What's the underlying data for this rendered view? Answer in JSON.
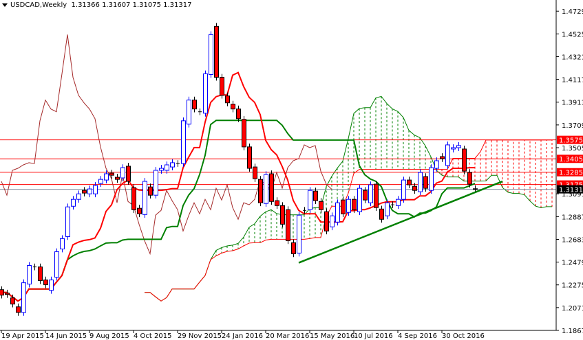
{
  "header": {
    "symbol": "USDCAD,Weekly",
    "ohlc": "1.31366 1.31607 1.31075 1.31317"
  },
  "chart_data": {
    "type": "candlestick",
    "title": "USDCAD,Weekly",
    "indicator": "Ichimoku Kinko Hyo",
    "ylim": [
      1.1867,
      1.4829
    ],
    "y_ticks": [
      "1.47290",
      "1.45250",
      "1.43210",
      "1.41170",
      "1.39130",
      "1.37090",
      "1.35050",
      "1.30910",
      "1.28870",
      "1.26830",
      "1.24790",
      "1.22750",
      "1.20710",
      "1.18670"
    ],
    "x_ticks": [
      {
        "index": 0,
        "label": "19 Apr 2015"
      },
      {
        "index": 8,
        "label": "14 Jun 2015"
      },
      {
        "index": 16,
        "label": "9 Aug 2015"
      },
      {
        "index": 24,
        "label": "4 Oct 2015"
      },
      {
        "index": 32,
        "label": "29 Nov 2015"
      },
      {
        "index": 40,
        "label": "24 Jan 2016"
      },
      {
        "index": 48,
        "label": "20 Mar 2016"
      },
      {
        "index": 56,
        "label": "15 May 2016"
      },
      {
        "index": 64,
        "label": "10 Jul 2016"
      },
      {
        "index": 72,
        "label": "4 Sep 2016"
      },
      {
        "index": 80,
        "label": "30 Oct 2016"
      }
    ],
    "candles_open_close": [
      [
        1.2232,
        1.2183
      ],
      [
        1.2201,
        1.2189
      ],
      [
        1.2158,
        1.2103
      ],
      [
        1.2078,
        1.2028
      ],
      [
        1.2028,
        1.2294
      ],
      [
        1.2282,
        1.2449
      ],
      [
        1.2436,
        1.2436
      ],
      [
        1.2436,
        1.2313
      ],
      [
        1.2319,
        1.2276
      ],
      [
        1.2226,
        1.2319
      ],
      [
        1.2344,
        1.2572
      ],
      [
        1.2597,
        1.269
      ],
      [
        1.2708,
        1.2974
      ],
      [
        1.298,
        1.3042
      ],
      [
        1.3042,
        1.3091
      ],
      [
        1.3122,
        1.3098
      ],
      [
        1.3091,
        1.3135
      ],
      [
        1.3091,
        1.3166
      ],
      [
        1.3184,
        1.3221
      ],
      [
        1.3215,
        1.3271
      ],
      [
        1.3277,
        1.3258
      ],
      [
        1.324,
        1.3221
      ],
      [
        1.3234,
        1.3326
      ],
      [
        1.3339,
        1.3203
      ],
      [
        1.3147,
        1.2949
      ],
      [
        1.2962,
        1.2912
      ],
      [
        1.2906,
        1.3203
      ],
      [
        1.3153,
        1.3079
      ],
      [
        1.3079,
        1.3302
      ],
      [
        1.3302,
        1.332
      ],
      [
        1.3302,
        1.3351
      ],
      [
        1.3332,
        1.337
      ],
      [
        1.3363,
        1.3363
      ],
      [
        1.3363,
        1.3746
      ],
      [
        1.3716,
        1.3932
      ],
      [
        1.3932,
        1.3852
      ],
      [
        1.3827,
        1.3827
      ],
      [
        1.3814,
        1.4167
      ],
      [
        1.4161,
        1.4519
      ],
      [
        1.4593,
        1.4136
      ],
      [
        1.4136,
        1.3975
      ],
      [
        1.3969,
        1.3907
      ],
      [
        1.3895,
        1.3852
      ],
      [
        1.3852,
        1.3765
      ],
      [
        1.3759,
        1.3512
      ],
      [
        1.3512,
        1.332
      ],
      [
        1.3332,
        1.3227
      ],
      [
        1.3221,
        1.3011
      ],
      [
        1.3005,
        1.3264
      ],
      [
        1.3271,
        1.3023
      ],
      [
        1.303,
        1.2986
      ],
      [
        1.2986,
        1.2819
      ],
      [
        1.2949,
        1.2671
      ],
      [
        1.2653,
        1.2554
      ],
      [
        1.256,
        1.29
      ],
      [
        1.2943,
        1.2943
      ],
      [
        1.2949,
        1.3122
      ],
      [
        1.3116,
        1.303
      ],
      [
        1.3023,
        1.2949
      ],
      [
        1.2931,
        1.2758
      ],
      [
        1.2795,
        1.2894
      ],
      [
        1.2838,
        1.3011
      ],
      [
        1.3036,
        1.2912
      ],
      [
        1.2925,
        1.3042
      ],
      [
        1.3042,
        1.2949
      ],
      [
        1.2931,
        1.3141
      ],
      [
        1.3122,
        1.3036
      ],
      [
        1.3011,
        1.3172
      ],
      [
        1.3178,
        1.2968
      ],
      [
        1.2955,
        1.2863
      ],
      [
        1.2894,
        1.3011
      ],
      [
        1.2993,
        1.2993
      ],
      [
        1.2986,
        1.3042
      ],
      [
        1.3042,
        1.3215
      ],
      [
        1.3215,
        1.3172
      ],
      [
        1.3159,
        1.3122
      ],
      [
        1.311,
        1.3283
      ],
      [
        1.3246,
        1.3141
      ],
      [
        1.3122,
        1.3326
      ],
      [
        1.332,
        1.3388
      ],
      [
        1.3425,
        1.3407
      ],
      [
        1.3345,
        1.353
      ],
      [
        1.3493,
        1.3505
      ],
      [
        1.3505,
        1.3524
      ],
      [
        1.3493,
        1.3295
      ],
      [
        1.3283,
        1.3178
      ],
      [
        1.3137,
        1.3132
      ]
    ],
    "wick_extension": 0.003,
    "tenkan_period": 9,
    "kijun_period": 26,
    "senkou_b_period": 52,
    "displacement": 26,
    "levels": [
      {
        "price": 1.3575,
        "label": "1.35750",
        "color": "#ff0000"
      },
      {
        "price": 1.3405,
        "label": "1.34050",
        "color": "#ff0000"
      },
      {
        "price": 1.3285,
        "label": "1.32850",
        "color": "#ff0000"
      },
      {
        "price": 1.3175,
        "label": "1.31750",
        "color": "#ff0000"
      },
      {
        "price": 1.31317,
        "label": "1.31317",
        "color": "#000000"
      }
    ],
    "trendline": {
      "from": {
        "index": 54,
        "price": 1.2473
      },
      "to": {
        "index": 91,
        "price": 1.3203
      },
      "color": "#008000"
    },
    "colors": {
      "bull": "#0000ff",
      "bear": "#ff0000",
      "tenkan": "#ff0000",
      "kijun": "#008000",
      "chikou": "#a52a2a",
      "cloud_up": "#008000",
      "cloud_down": "#ff0000"
    }
  }
}
